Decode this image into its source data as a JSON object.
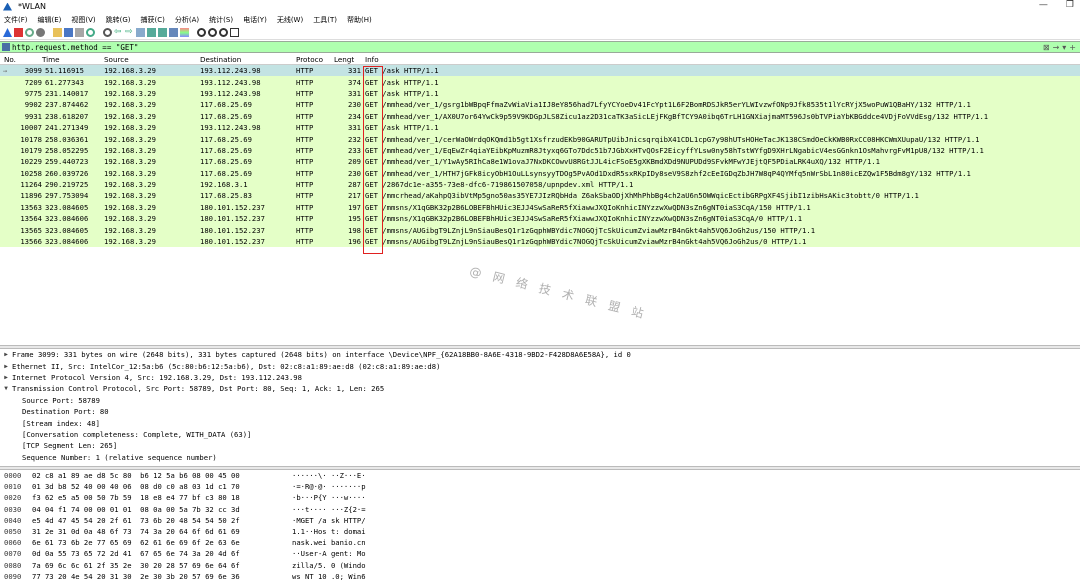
{
  "window": {
    "title": "*WLAN"
  },
  "menu": [
    "文件(F)",
    "编辑(E)",
    "视图(V)",
    "跳转(G)",
    "捕获(C)",
    "分析(A)",
    "统计(S)",
    "电话(Y)",
    "无线(W)",
    "工具(T)",
    "帮助(H)"
  ],
  "filter": {
    "text": "http.request.method == \"GET\""
  },
  "columns": [
    "No.",
    "Time",
    "Source",
    "Destination",
    "Protoco",
    "Lengt",
    "Info"
  ],
  "packets": [
    {
      "no": "3099",
      "time": "51.116915",
      "src": "192.168.3.29",
      "dst": "193.112.243.98",
      "proto": "HTTP",
      "len": "331",
      "info": "GET /ask HTTP/1.1"
    },
    {
      "no": "7209",
      "time": "61.277343",
      "src": "192.168.3.29",
      "dst": "193.112.243.98",
      "proto": "HTTP",
      "len": "374",
      "info": "GET /ask HTTP/1.1"
    },
    {
      "no": "9775",
      "time": "231.140017",
      "src": "192.168.3.29",
      "dst": "193.112.243.98",
      "proto": "HTTP",
      "len": "331",
      "info": "GET /ask HTTP/1.1"
    },
    {
      "no": "9902",
      "time": "237.874462",
      "src": "192.168.3.29",
      "dst": "117.68.25.69",
      "proto": "HTTP",
      "len": "230",
      "info": "GET /mmhead/ver_1/gsrg1bWBpqFfmaZvWiaVia1IJ8eY856had7LfyYCYoeDv41FcYpt1L6F2BomRDSJkR5erYLWIvzwfONp9Jfk8535t1lYcRYjX5woPuW1QBaHY/132 HTTP/1.1"
    },
    {
      "no": "9931",
      "time": "238.618207",
      "src": "192.168.3.29",
      "dst": "117.68.25.69",
      "proto": "HTTP",
      "len": "234",
      "info": "GET /mmhead/ver_1/AX0U7or64YwCk9p59V9KDGpJLS8Zicu1az2D31caTK3aSicLEjFKgBfTCY9A0ibq6TrLH1GNXiajmaMT596Js0bTVPiaYbKBGddce4VDjFoVVdEsg/132 HTTP/1.1"
    },
    {
      "no": "10007",
      "time": "241.271349",
      "src": "192.168.3.29",
      "dst": "193.112.243.98",
      "proto": "HTTP",
      "len": "331",
      "info": "GET /ask HTTP/1.1"
    },
    {
      "no": "10178",
      "time": "258.036361",
      "src": "192.168.3.29",
      "dst": "117.68.25.69",
      "proto": "HTTP",
      "len": "232",
      "info": "GET /mmhead/ver_1/cerWaOWrdqOKQmd1b5gt1XsfrzudEKb90GARUTpUibJnicsqrqibX41CDL1cpG7y98hUTsHOHeTacJK138CSmdOeCkKWB0RxCC08HKCWmXUupaU/132 HTTP/1.1"
    },
    {
      "no": "10179",
      "time": "258.052295",
      "src": "192.168.3.29",
      "dst": "117.68.25.69",
      "proto": "HTTP",
      "len": "233",
      "info": "GET /mmhead/ver_1/EqEwZr4qiaYEibKpMuzmR8Jtyxq6GTo7Ddc51b7JGbXxHTvQOsF2EicyffYLsw0ny58hTstWYfgD9XHrLNgabicV4esGGnkn1OsMahvrgFvM1pU8/132 HTTP/1.1"
    },
    {
      "no": "10229",
      "time": "259.440723",
      "src": "192.168.3.29",
      "dst": "117.68.25.69",
      "proto": "HTTP",
      "len": "209",
      "info": "GET /mmhead/ver_1/Y1wAy5RIhCa8e1W1ovaJ7NxDKCOwvU8RGtJJL4icFSoE5gXKBmdXDd9NUPUDd9SFvkMFwYJEjtQF5PDiaLRK4uXQ/132 HTTP/1.1"
    },
    {
      "no": "10258",
      "time": "260.039726",
      "src": "192.168.3.29",
      "dst": "117.68.25.69",
      "proto": "HTTP",
      "len": "230",
      "info": "GET /mmhead/ver_1/HTH7jGFk8icyObH1OuLLsynsyyTDOg5PvAOd1DxdR5sxRKpIDy8seV9S8zhf2cEeIGDqZbJH7W8qP4QYMfq5nWrSbL1n80icEZQw1F5Bdm8gY/132 HTTP/1.1"
    },
    {
      "no": "11264",
      "time": "290.219725",
      "src": "192.168.3.29",
      "dst": "192.168.3.1",
      "proto": "HTTP",
      "len": "287",
      "info": "GET /2867dc1e-a355-73e8-dfc6-719861507058/upnpdev.xml HTTP/1.1"
    },
    {
      "no": "11896",
      "time": "297.753094",
      "src": "192.168.3.29",
      "dst": "117.68.25.83",
      "proto": "HTTP",
      "len": "217",
      "info": "GET /mmcrhead/aKahpQ3ibVtMp5gno50as35YE7JIzRQbHda Z6akSbaODjXhMhPhbBg4ch2aU6n5OWWqicEctibGRPgXF4SjibI1zibHsAKic3tobtt/0 HTTP/1.1"
    },
    {
      "no": "13563",
      "time": "323.084605",
      "src": "192.168.3.29",
      "dst": "180.101.152.237",
      "proto": "HTTP",
      "len": "197",
      "info": "GET /mmsns/X1qGBK32p2B6LOBEFBhHUic3EJJ4SwSaReR5fXiawwJXQIoKnhicINYzzwXwQDN3sZn6gNT0iaS3CqA/150 HTTP/1.1"
    },
    {
      "no": "13564",
      "time": "323.084606",
      "src": "192.168.3.29",
      "dst": "180.101.152.237",
      "proto": "HTTP",
      "len": "195",
      "info": "GET /mmsns/X1qGBK32p2B6LOBEFBhHUic3EJJ4SwSaReR5fXiawwJXQIoKnhicINYzzwXwQDN3sZn6gNT0iaS3CqA/0 HTTP/1.1"
    },
    {
      "no": "13565",
      "time": "323.084605",
      "src": "192.168.3.29",
      "dst": "180.101.152.237",
      "proto": "HTTP",
      "len": "198",
      "info": "GET /mmsns/AUGibgT9LZnjL9nSiauBesQ1r1zGqphWBYdic7NOGQjTcSkUicumZviawMzrB4nGkt4ah5VQ6JoGh2us/150 HTTP/1.1"
    },
    {
      "no": "13566",
      "time": "323.084606",
      "src": "192.168.3.29",
      "dst": "180.101.152.237",
      "proto": "HTTP",
      "len": "196",
      "info": "GET /mmsns/AUGibgT9LZnjL9nSiauBesQ1r1zGqphWBYdic7NOGQjTcSkUicumZviawMzrB4nGkt4ah5VQ6JoGh2us/0 HTTP/1.1"
    }
  ],
  "watermark": "@ 网 络 技 术 联 盟 站",
  "details": [
    {
      "arrow": ">",
      "text": "Frame 3099: 331 bytes on wire (2648 bits), 331 bytes captured (2648 bits) on interface \\Device\\NPF_{62A18BB0-8A6E-4318-9BD2-F428D8A6E58A}, id 0"
    },
    {
      "arrow": ">",
      "text": "Ethernet II, Src: IntelCor_12:5a:b6 (5c:80:b6:12:5a:b6), Dst: 02:c8:a1:89:ae:d8 (02:c8:a1:89:ae:d8)"
    },
    {
      "arrow": ">",
      "text": "Internet Protocol Version 4, Src: 192.168.3.29, Dst: 193.112.243.98"
    },
    {
      "arrow": "v",
      "text": "Transmission Control Protocol, Src Port: 58789, Dst Port: 80, Seq: 1, Ack: 1, Len: 265"
    },
    {
      "child": true,
      "text": "Source Port: 58789"
    },
    {
      "child": true,
      "text": "Destination Port: 80"
    },
    {
      "child": true,
      "text": "[Stream index: 48]"
    },
    {
      "child": true,
      "text": "[Conversation completeness: Complete, WITH_DATA (63)]"
    },
    {
      "child": true,
      "text": "[TCP Segment Len: 265]"
    },
    {
      "child": true,
      "text": "Sequence Number: 1    (relative sequence number)"
    }
  ],
  "hex": [
    {
      "off": "0000",
      "bytes": "02 c8 a1 89 ae d8 5c 80  b6 12 5a b6 08 00 45 00",
      "ascii": "······\\· ··Z···E·"
    },
    {
      "off": "0010",
      "bytes": "01 3d b8 52 40 00 40 06  08 d0 c0 a8 03 1d c1 70",
      "ascii": "·=·R@·@· ·······p"
    },
    {
      "off": "0020",
      "bytes": "f3 62 e5 a5 00 50 7b 59  18 e8 e4 77 bf c3 80 18",
      "ascii": "·b···P{Y ···w····"
    },
    {
      "off": "0030",
      "bytes": "04 04 f1 74 00 00 01 01  08 0a 00 5a 7b 32 cc 3d",
      "ascii": "···t···· ···Z{2·="
    },
    {
      "off": "0040",
      "bytes": "e5 4d 47 45 54 20 2f 61  73 6b 20 48 54 54 50 2f",
      "ascii": "·MGET /a sk HTTP/"
    },
    {
      "off": "0050",
      "bytes": "31 2e 31 0d 0a 48 6f 73  74 3a 20 64 6f 6d 61 69",
      "ascii": "1.1··Hos t: domai"
    },
    {
      "off": "0060",
      "bytes": "6e 61 73 6b 2e 77 65 69  62 61 6e 69 6f 2e 63 6e",
      "ascii": "nask.wei banio.cn"
    },
    {
      "off": "0070",
      "bytes": "0d 0a 55 73 65 72 2d 41  67 65 6e 74 3a 20 4d 6f",
      "ascii": "··User-A gent: Mo"
    },
    {
      "off": "0080",
      "bytes": "7a 69 6c 6c 61 2f 35 2e  30 20 28 57 69 6e 64 6f",
      "ascii": "zilla/5. 0 (Windo"
    },
    {
      "off": "0090",
      "bytes": "77 73 20 4e 54 20 31 30  2e 30 3b 20 57 69 6e 36",
      "ascii": "ws NT 10 .0; Win6"
    }
  ]
}
